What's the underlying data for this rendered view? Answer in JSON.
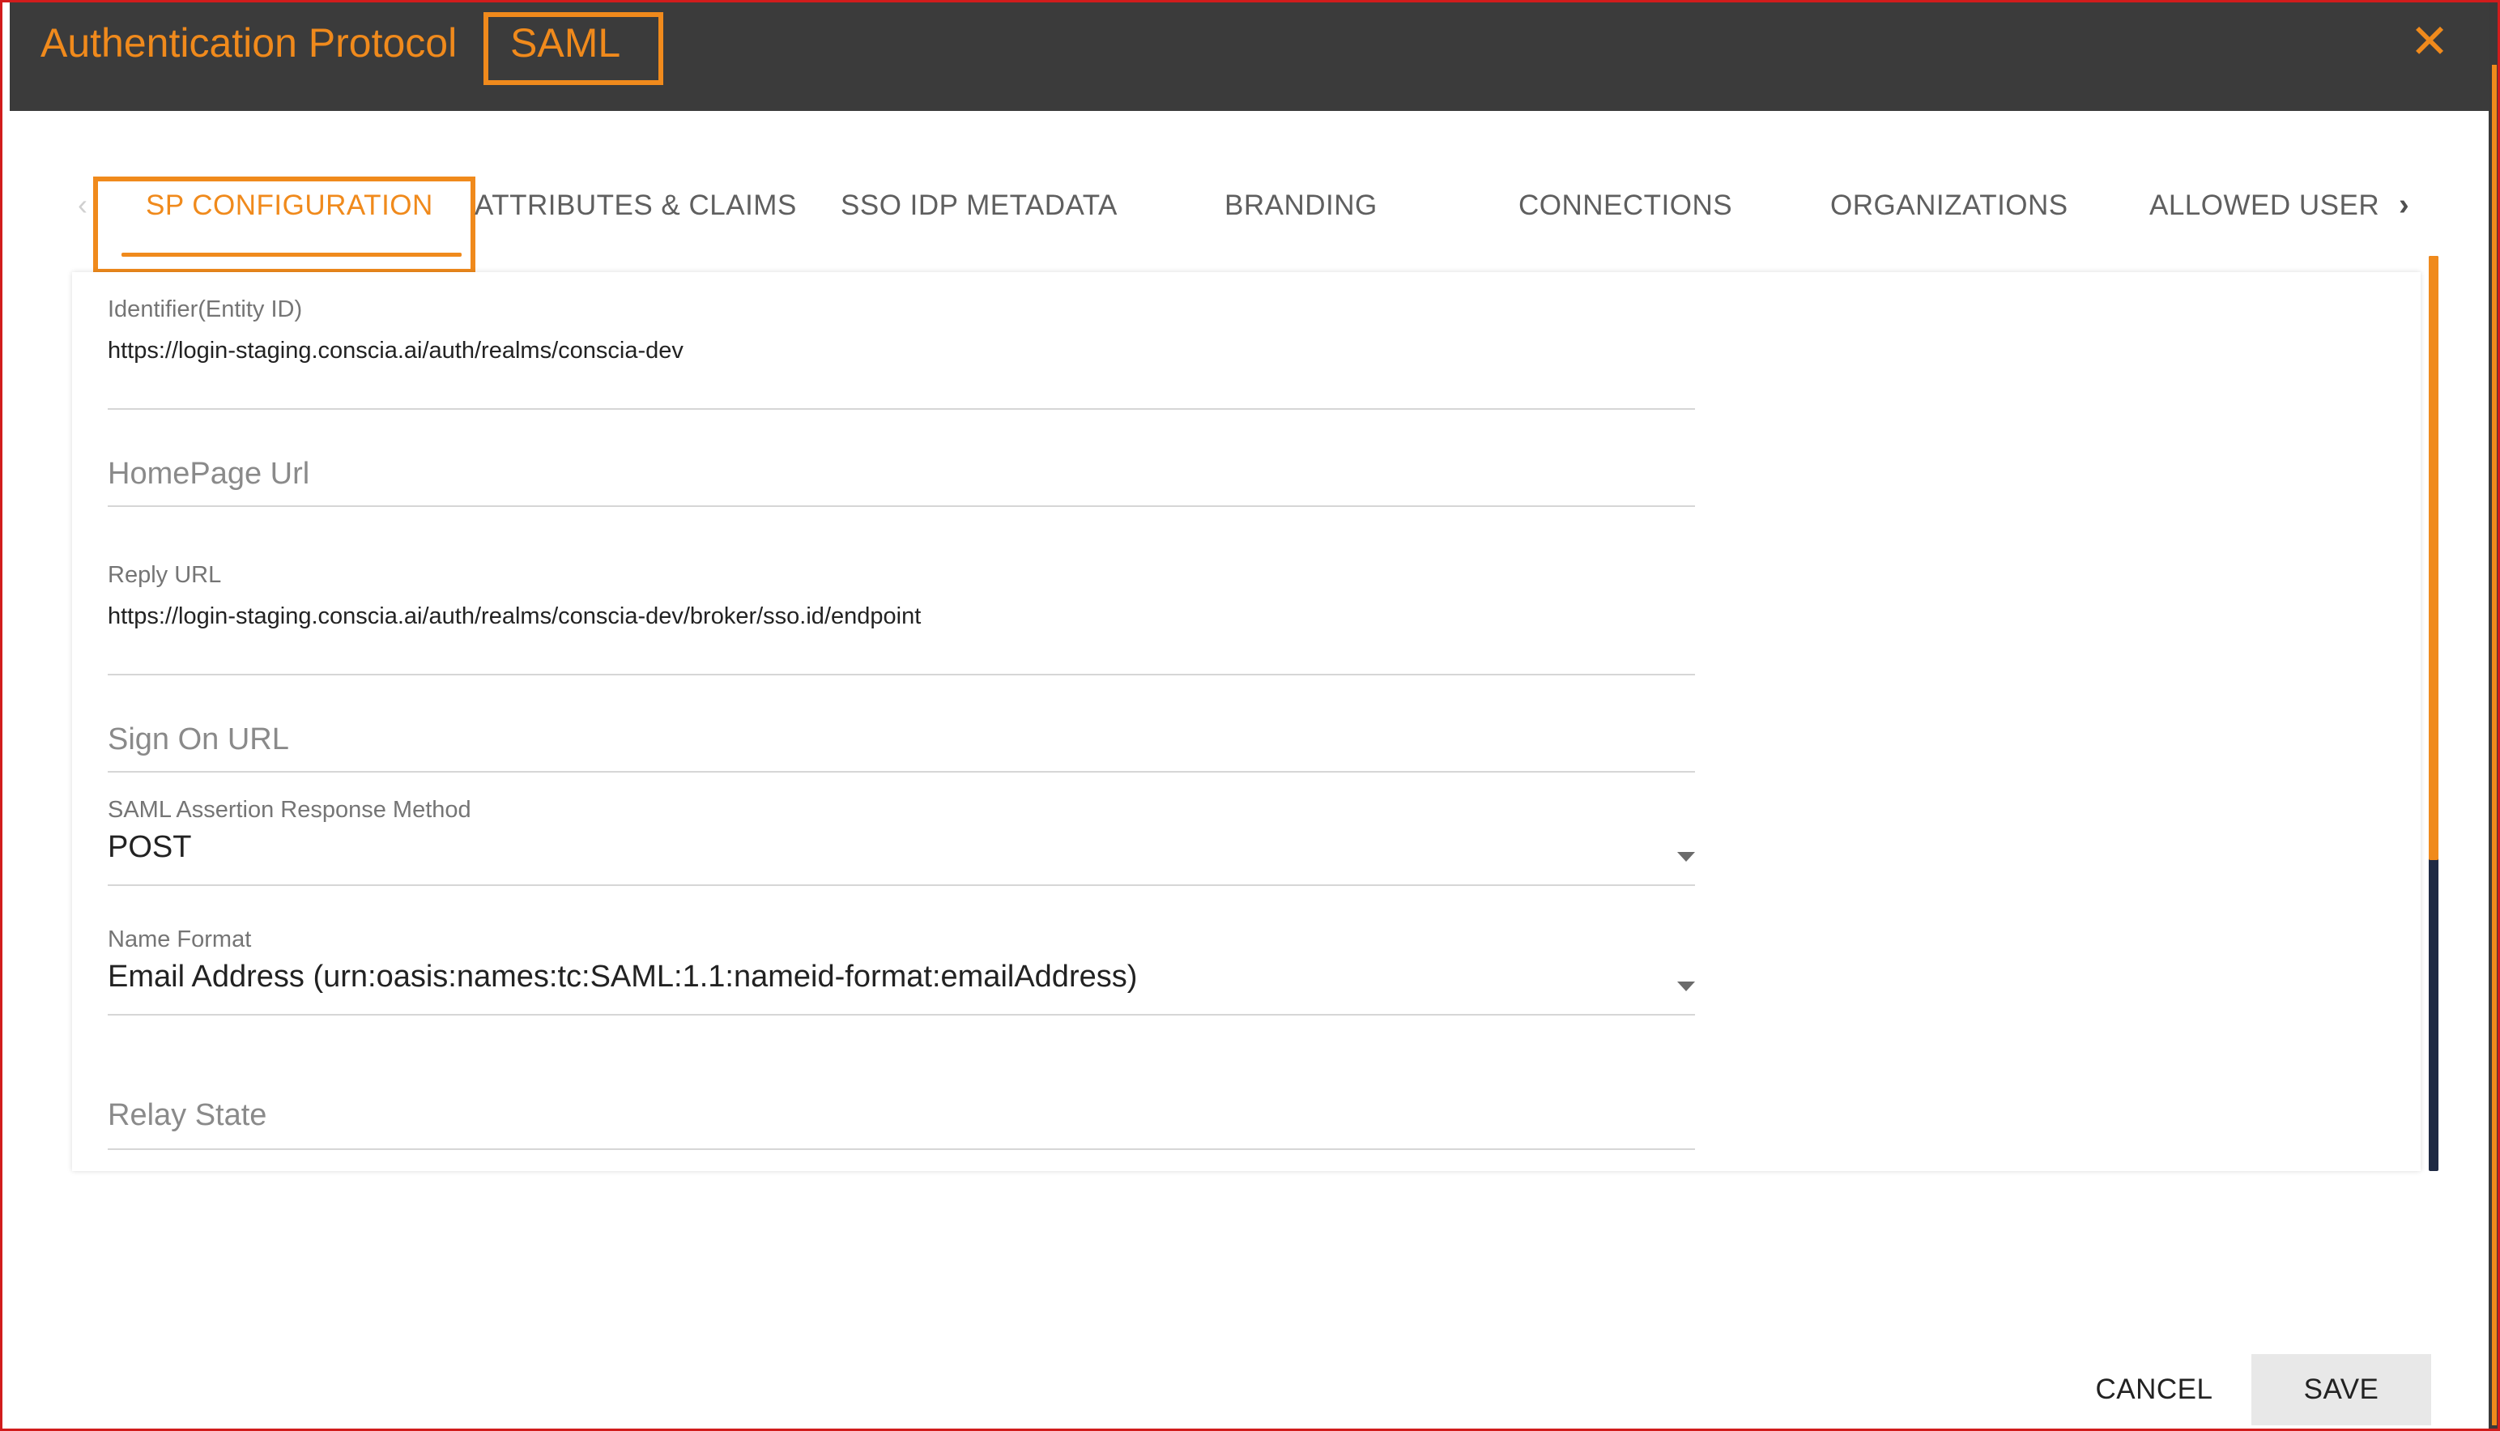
{
  "header": {
    "title": "Authentication Protocol",
    "protocol": "SAML",
    "close_icon": "close-icon",
    "color_background": "#3b3b3b",
    "color_accent": "#f08a1c"
  },
  "tabs": [
    {
      "label": "SP CONFIGURATION",
      "active": true
    },
    {
      "label": "ATTRIBUTES & CLAIMS",
      "active": false
    },
    {
      "label": "SSO IDP METADATA",
      "active": false
    },
    {
      "label": "BRANDING",
      "active": false
    },
    {
      "label": "CONNECTIONS",
      "active": false
    },
    {
      "label": "ORGANIZATIONS",
      "active": false
    },
    {
      "label": "ALLOWED USER",
      "active": false
    }
  ],
  "tab_nav": {
    "prev_icon": "chevron-left-icon",
    "next_icon": "chevron-right-icon"
  },
  "form": {
    "identifier": {
      "label": "Identifier(Entity ID)",
      "value": "https://login-staging.conscia.ai/auth/realms/conscia-dev"
    },
    "homepage_url": {
      "placeholder": "HomePage Url",
      "value": ""
    },
    "reply_url": {
      "label": "Reply URL",
      "value": "https://login-staging.conscia.ai/auth/realms/conscia-dev/broker/sso.id/endpoint"
    },
    "sign_on_url": {
      "placeholder": "Sign On URL",
      "value": ""
    },
    "response_method": {
      "label": "SAML Assertion Response Method",
      "value": "POST"
    },
    "name_format": {
      "label": "Name Format",
      "value": "Email Address (urn:oasis:names:tc:SAML:1.1:nameid-format:emailAddress)"
    },
    "relay_state": {
      "placeholder": "Relay State",
      "value": ""
    }
  },
  "actions": {
    "cancel_label": "CANCEL",
    "save_label": "SAVE"
  }
}
